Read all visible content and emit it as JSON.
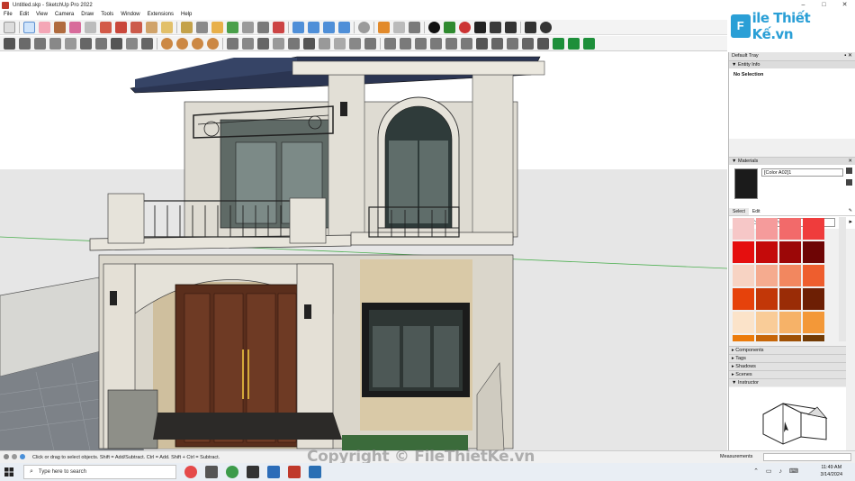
{
  "window": {
    "title": "Untitled.skp - SketchUp Pro 2022",
    "controls": [
      "–",
      "□",
      "✕"
    ]
  },
  "menubar": {
    "items": [
      "File",
      "Edit",
      "View",
      "Camera",
      "Draw",
      "Tools",
      "Window",
      "Extensions",
      "Help"
    ]
  },
  "brand": {
    "logo_mark": "F",
    "logo_text": "ile Thiết Kế.vn",
    "accent": "#2a9fd6"
  },
  "tray": {
    "header": "Default Tray",
    "entity_info": {
      "title": "Entity Info",
      "body": "No Selection"
    },
    "materials": {
      "title": "Materials",
      "name": "[Color A02]1",
      "tabs": [
        "Select",
        "Edit"
      ],
      "library": "Colors",
      "swatches": [
        "#f6c7c7",
        "#f59b9b",
        "#f26a6a",
        "#ef3c3c",
        "#e50f0f",
        "#c40a0a",
        "#9c0707",
        "#6e0505",
        "#f7d3c3",
        "#f5ab8f",
        "#f2875f",
        "#ee5e2e",
        "#e6420b",
        "#c23708",
        "#9a2c06",
        "#6d1f04",
        "#fbe3c9",
        "#f9cc98",
        "#f6b268",
        "#f39838",
        "#ec7b0a",
        "#c76608",
        "#9f5106",
        "#733b04"
      ]
    },
    "collapsed_panels": [
      "Components",
      "Tags",
      "Shadows",
      "Scenes",
      "Instructor"
    ]
  },
  "status": {
    "hint": "Click or drag to select objects. Shift = Add/Subtract. Ctrl = Add. Shift + Ctrl = Subtract.",
    "measurements_label": "Measurements"
  },
  "watermark": "Copyright © FileThietKe.vn",
  "taskbar": {
    "search_placeholder": "Type here to search",
    "time": "11:49 AM",
    "date": "3/14/2024"
  }
}
